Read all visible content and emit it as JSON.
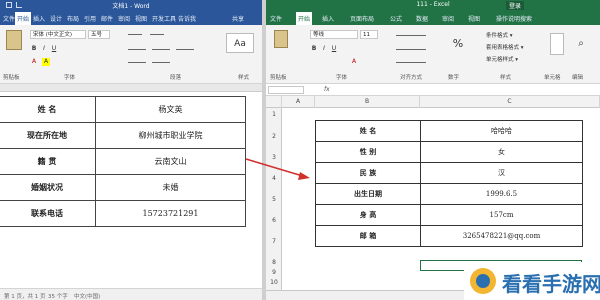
{
  "word": {
    "title": "文档1 - Word",
    "tabs": [
      "文件",
      "开始",
      "插入",
      "设计",
      "布局",
      "引用",
      "邮件",
      "审阅",
      "视图",
      "开发工具",
      "告诉我",
      "共享"
    ],
    "active_tab": "开始",
    "font_name": "宋体 (中文正文)",
    "font_size": "五号",
    "group_labels": [
      "剪贴板",
      "字体",
      "段落",
      "样式"
    ],
    "table": [
      {
        "label": "姓    名",
        "value": "杨文英"
      },
      {
        "label": "现在所在地",
        "value": "柳州城市职业学院"
      },
      {
        "label": "籍    贯",
        "value": "云南文山"
      },
      {
        "label": "婚姻状况",
        "value": "未婚"
      },
      {
        "label": "联系电话",
        "value": "15723721291"
      }
    ],
    "status": [
      "第 1 页，共 1 页",
      "35 个字",
      "中文(中国)"
    ]
  },
  "excel": {
    "title": "111 - Excel",
    "login": "登录",
    "tabs": [
      "文件",
      "开始",
      "插入",
      "页面布局",
      "公式",
      "数据",
      "审阅",
      "视图",
      "操作说明搜索"
    ],
    "active_tab": "开始",
    "font_name": "等线",
    "font_size": "11",
    "styles": [
      "条件格式 ▾",
      "套用表格格式 ▾",
      "单元格样式 ▾"
    ],
    "group_labels": [
      "剪贴板",
      "字体",
      "对齐方式",
      "数字",
      "样式",
      "单元格",
      "编辑"
    ],
    "col_headers": [
      "A",
      "B",
      "C"
    ],
    "row_headers": [
      "1",
      "2",
      "3",
      "4",
      "5",
      "6",
      "7",
      "8",
      "9",
      "10"
    ],
    "table": [
      {
        "label": "姓    名",
        "value": "哈哈哈"
      },
      {
        "label": "性    别",
        "value": "女"
      },
      {
        "label": "民    族",
        "value": "汉"
      },
      {
        "label": "出生日期",
        "value": "1999.6.5"
      },
      {
        "label": "身    高",
        "value": "157cm"
      },
      {
        "label": "邮    箱",
        "value": "3265478221@qq.com"
      }
    ]
  },
  "watermark": "看看手游网",
  "colors": {
    "word": "#2b579a",
    "excel": "#217346",
    "arrow": "#d0312d"
  },
  "icons": [
    "paste-icon",
    "bold-icon",
    "italic-icon",
    "underline-icon",
    "arrow-icon",
    "fx-icon",
    "logo-icon"
  ]
}
